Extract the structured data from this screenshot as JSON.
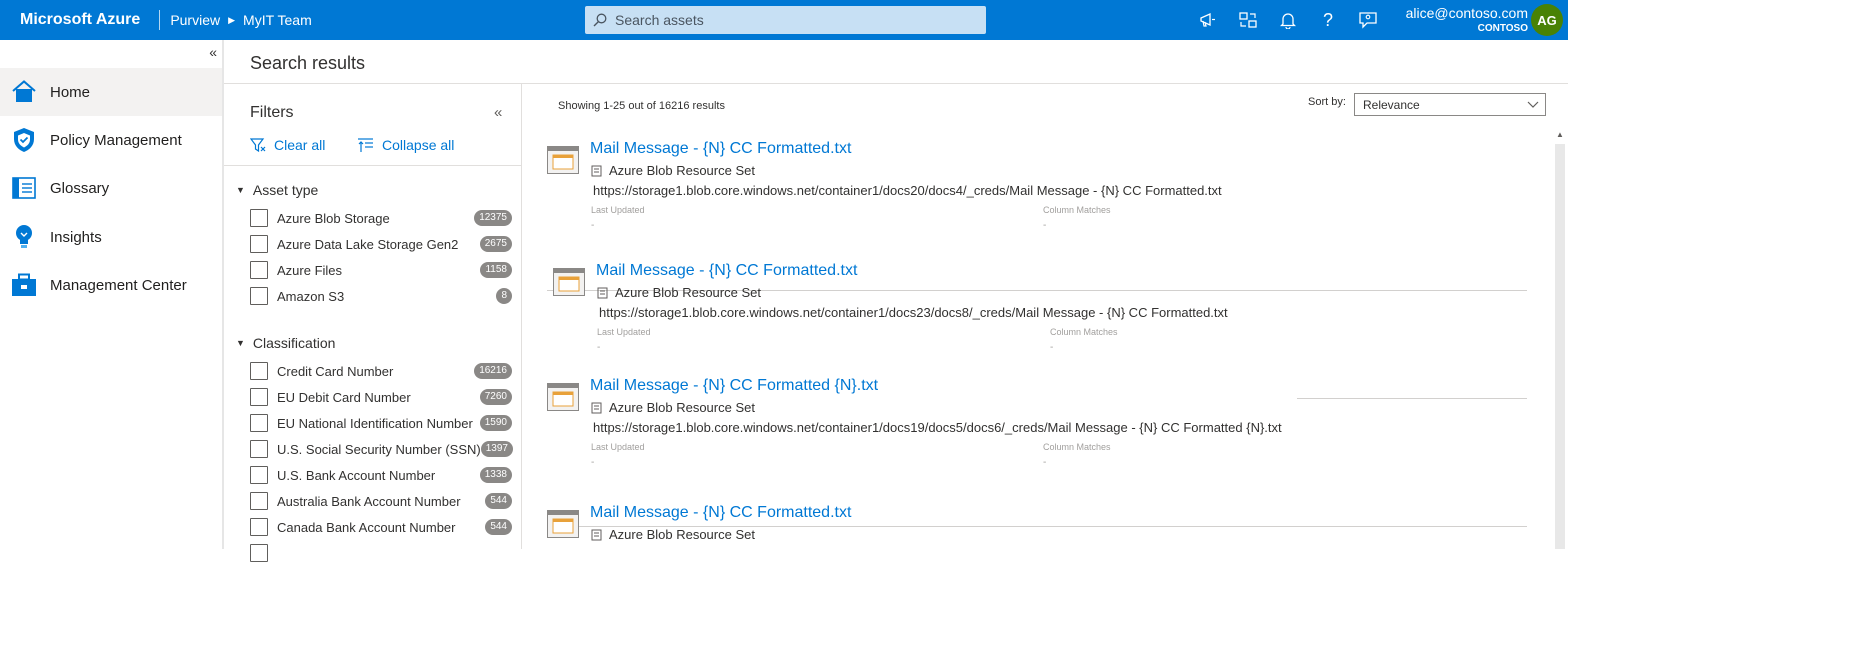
{
  "header": {
    "brand": "Microsoft Azure",
    "crumbs": [
      "Purview",
      "MyIT Team"
    ],
    "search_placeholder": "Search assets",
    "user_email": "alice@contoso.com",
    "user_org": "CONTOSO",
    "avatar_initials": "AG",
    "colors": {
      "bar": "#0078d4",
      "search": "#c7e0f4",
      "avatar": "#498205"
    }
  },
  "nav": {
    "items": [
      {
        "label": "Home",
        "icon": "home-icon"
      },
      {
        "label": "Policy Management",
        "icon": "shield-icon"
      },
      {
        "label": "Glossary",
        "icon": "book-icon"
      },
      {
        "label": "Insights",
        "icon": "lightbulb-icon"
      },
      {
        "label": "Management Center",
        "icon": "toolbox-icon"
      }
    ]
  },
  "page": {
    "title": "Search results"
  },
  "filters": {
    "title": "Filters",
    "clear_all": "Clear all",
    "collapse_all": "Collapse all",
    "asset_type": {
      "label": "Asset type",
      "items": [
        {
          "label": "Azure Blob Storage",
          "count": "12375"
        },
        {
          "label": "Azure Data Lake Storage Gen2",
          "count": "2675"
        },
        {
          "label": "Azure Files",
          "count": "1158"
        },
        {
          "label": "Amazon S3",
          "count": "8"
        }
      ]
    },
    "classification": {
      "label": "Classification",
      "items": [
        {
          "label": "Credit Card Number",
          "count": "16216"
        },
        {
          "label": "EU Debit Card Number",
          "count": "7260"
        },
        {
          "label": "EU National Identification Number",
          "count": "1590"
        },
        {
          "label": "U.S. Social Security Number (SSN)",
          "count": "1397"
        },
        {
          "label": "U.S. Bank Account Number",
          "count": "1338"
        },
        {
          "label": "Australia Bank Account Number",
          "count": "544"
        },
        {
          "label": "Canada Bank Account Number",
          "count": "544"
        }
      ]
    }
  },
  "results": {
    "summary": "Showing 1-25 out of 16216 results",
    "sort_label": "Sort by:",
    "sort_value": "Relevance",
    "meta_labels": {
      "updated": "Last Updated",
      "matches": "Column Matches"
    },
    "items": [
      {
        "title": "Mail Message - {N} CC Formatted.txt",
        "type": "Azure Blob Resource Set",
        "path": "https://storage1.blob.core.windows.net/container1/docs20/docs4/_creds/Mail Message - {N} CC Formatted.txt",
        "updated": "-",
        "matches": "-"
      },
      {
        "title": "Mail Message - {N} CC Formatted.txt",
        "type": "Azure Blob Resource Set",
        "path": "https://storage1.blob.core.windows.net/container1/docs23/docs8/_creds/Mail Message - {N} CC Formatted.txt",
        "updated": "-",
        "matches": "-"
      },
      {
        "title": "Mail Message - {N} CC Formatted {N}.txt",
        "type": "Azure Blob Resource Set",
        "path": "https://storage1.blob.core.windows.net/container1/docs19/docs5/docs6/_creds/Mail Message - {N} CC Formatted {N}.txt",
        "updated": "-",
        "matches": "-"
      },
      {
        "title": "Mail Message - {N} CC Formatted.txt",
        "type": "Azure Blob Resource Set"
      }
    ]
  }
}
